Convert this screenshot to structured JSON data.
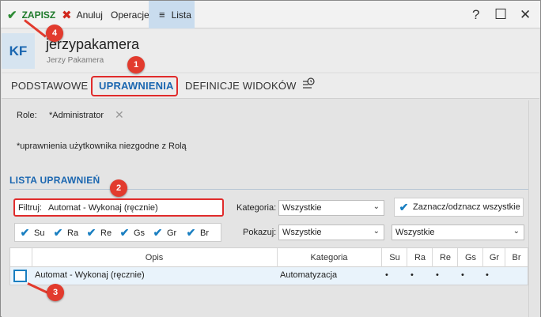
{
  "toolbar": {
    "save_label": "ZAPISZ",
    "cancel_label": "Anuluj",
    "operations_label": "Operacje",
    "list_label": "Lista",
    "help_symbol": "?",
    "maximize_symbol": "☐",
    "close_symbol": "✕"
  },
  "header": {
    "avatar_initials": "KF",
    "title": "jerzypakamera",
    "subtitle": "Jerzy Pakamera"
  },
  "tabs": {
    "basic": "PODSTAWOWE",
    "permissions": "UPRAWNIENIA",
    "view_definitions": "DEFINICJE WIDOKÓW",
    "active": "UPRAWNIENIA"
  },
  "roles": {
    "label": "Role:",
    "value": "*Administrator"
  },
  "note": "*uprawnienia użytkownika niezgodne z Rolą",
  "permissions_list": {
    "title": "LISTA UPRAWNIEŃ",
    "filter_label": "Filtruj:",
    "filter_value": "Automat - Wykonaj (ręcznie)",
    "category_label": "Kategoria:",
    "category_value": "Wszystkie",
    "select_all_label": "Zaznacz/odznacz wszystkie",
    "show_label": "Pokazuj:",
    "show_value": "Wszystkie",
    "show_value_2": "Wszystkie",
    "perm_flags": [
      "Su",
      "Ra",
      "Re",
      "Gs",
      "Gr",
      "Br"
    ]
  },
  "table": {
    "columns": [
      "Opis",
      "Kategoria",
      "Su",
      "Ra",
      "Re",
      "Gs",
      "Gr",
      "Br"
    ],
    "rows": [
      {
        "opis": "Automat - Wykonaj (ręcznie)",
        "kategoria": "Automatyzacja",
        "su": "•",
        "ra": "•",
        "re": "•",
        "gs": "•",
        "gr": "•",
        "br": ""
      }
    ]
  },
  "annotations": [
    "1",
    "2",
    "3",
    "4"
  ],
  "colors": {
    "accent": "#1a66b0",
    "save_green": "#2e8b35",
    "cancel_red": "#d0271d",
    "highlight_red": "#e02b2b",
    "badge_red": "#e23b2e"
  }
}
